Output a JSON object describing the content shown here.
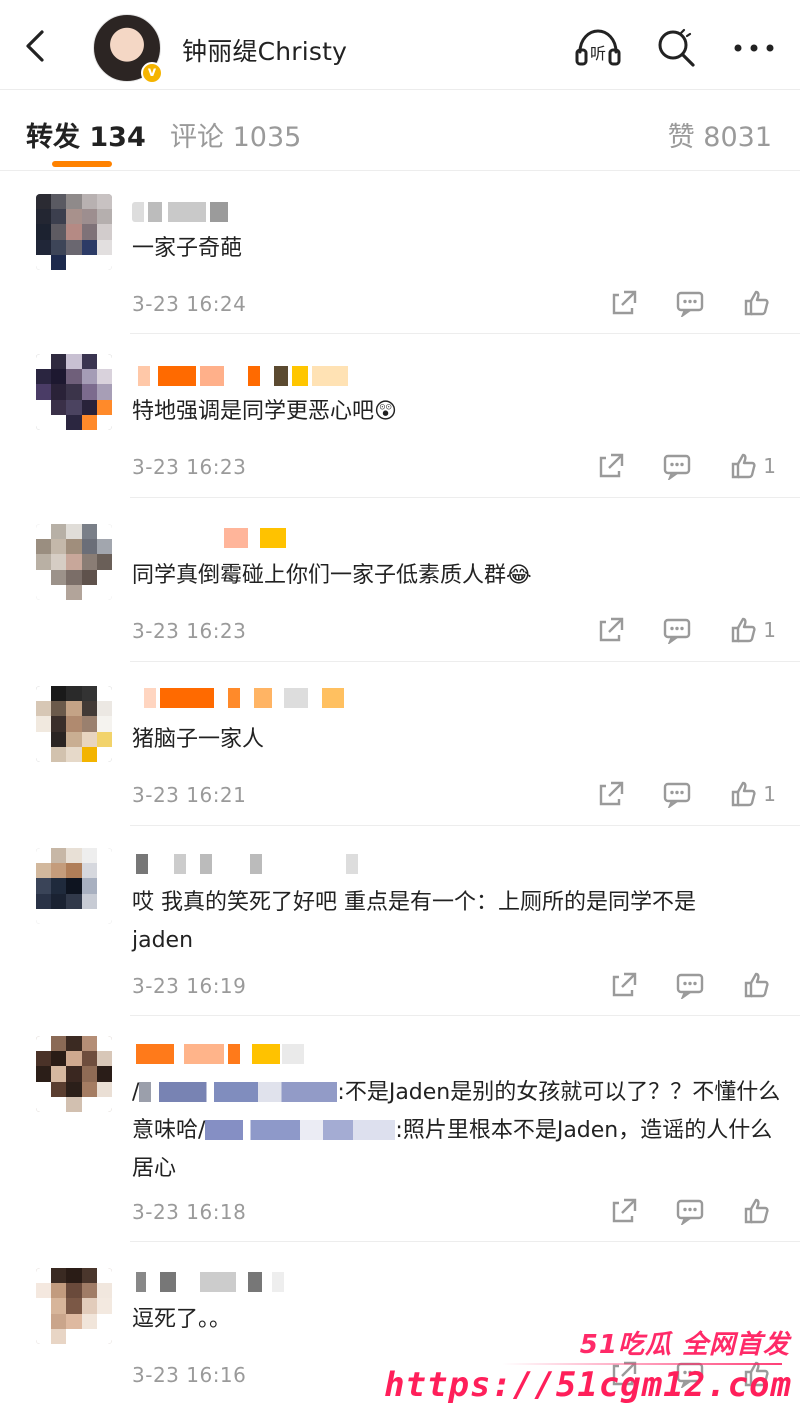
{
  "header": {
    "title": "钟丽缇Christy",
    "verified_badge": "v",
    "icons": [
      "back-icon",
      "listen-icon",
      "search-icon",
      "more-icon"
    ],
    "listen_label": "听"
  },
  "tabs": {
    "repost": "转发 134",
    "comment": "评论 1035",
    "like": "赞 8031",
    "active": "repost",
    "accent": "#ff8200"
  },
  "comments": [
    {
      "text": "一家子奇葩",
      "time": "3-23 16:24",
      "likes": ""
    },
    {
      "text": "特地强调是同学更恶心吧😲",
      "time": "3-23 16:23",
      "likes": "1"
    },
    {
      "text": "同学真倒霉碰上你们一家子低素质人群😂",
      "time": "3-23 16:23",
      "likes": "1"
    },
    {
      "text": "猪脑子一家人",
      "time": "3-23 16:21",
      "likes": "1"
    },
    {
      "text": "哎 我真的笑死了好吧 重点是有一个：上厕所的是同学不是jaden",
      "time": "3-23 16:19",
      "likes": ""
    },
    {
      "text_a": "/",
      "text_b": ":不是Jaden是别的女孩就可以了？？不懂什么意味哈/",
      "text_c": ":照片里根本不是Jaden，造谣的人什么居心",
      "time": "3-23 16:18",
      "likes": ""
    },
    {
      "text": "逗死了。。",
      "time": "3-23 16:16",
      "likes": ""
    }
  ],
  "watermark": {
    "line1": "51吃瓜 全网首发",
    "line2": "https://51cgm12.com",
    "color": "#ff1f5a"
  }
}
